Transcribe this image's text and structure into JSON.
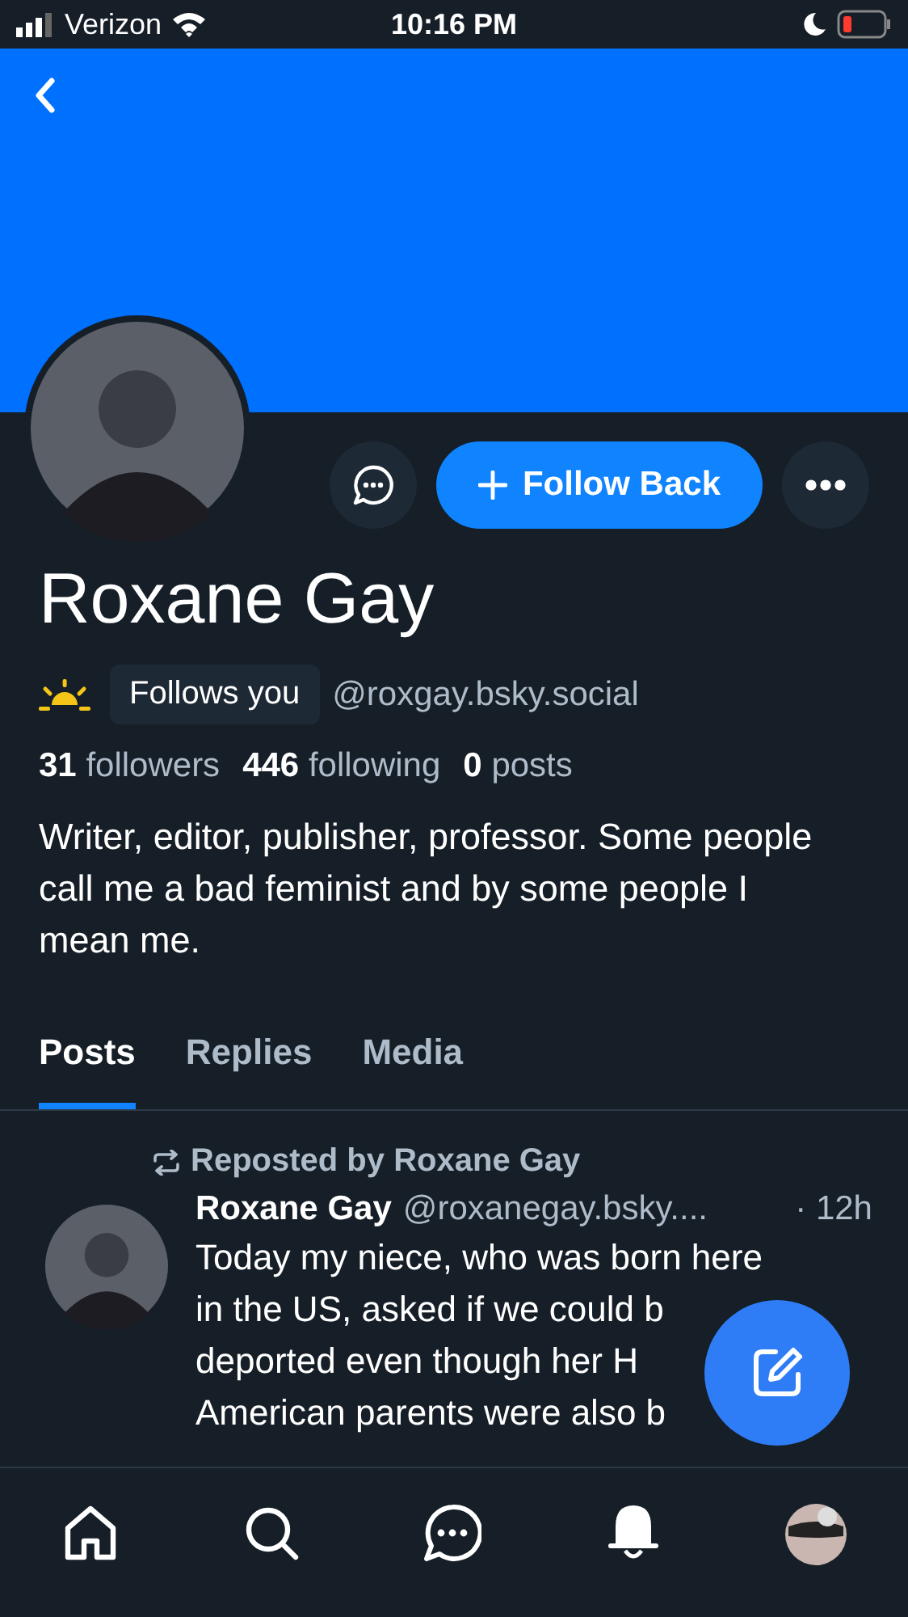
{
  "status_bar": {
    "carrier": "Verizon",
    "time": "10:16 PM",
    "battery_low": true
  },
  "profile": {
    "name": "Roxane Gay",
    "follows_you": "Follows you",
    "handle": "@roxgay.bsky.social",
    "stats": [
      {
        "count": "31",
        "label": "followers"
      },
      {
        "count": "446",
        "label": "following"
      },
      {
        "count": "0",
        "label": "posts"
      }
    ],
    "bio": "Writer, editor, publisher, professor. Some people call me a bad feminist and by some people I mean me.",
    "follow_button": "Follow Back"
  },
  "tabs": [
    {
      "label": "Posts",
      "selected": true
    },
    {
      "label": "Replies",
      "selected": false
    },
    {
      "label": "Media",
      "selected": false
    }
  ],
  "post": {
    "repost_label": "Reposted by Roxane Gay",
    "author": "Roxane Gay",
    "handle": "@roxanegay.bsky....",
    "time": "· 12h",
    "lines": [
      "Today my niece, who was born here",
      "in the US, asked if we could b",
      "deported even though her H",
      "American parents were also b"
    ]
  },
  "nav": [
    {
      "kind": "home"
    },
    {
      "kind": "search"
    },
    {
      "kind": "chat"
    },
    {
      "kind": "bell"
    },
    {
      "kind": "avatar"
    }
  ]
}
